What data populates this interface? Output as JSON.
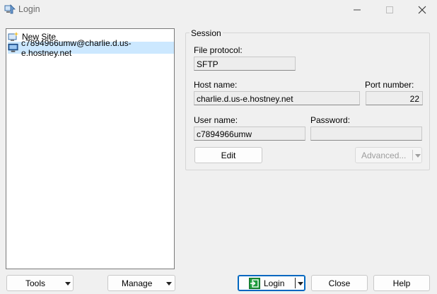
{
  "window": {
    "title": "Login"
  },
  "sites": [
    {
      "label": "New Site",
      "icon": "new-site-icon",
      "selected": false
    },
    {
      "label": "c7894966umw@charlie.d.us-e.hostney.net",
      "icon": "computer-icon",
      "selected": true
    }
  ],
  "session": {
    "group_label": "Session",
    "file_protocol_label": "File protocol:",
    "file_protocol_value": "SFTP",
    "host_label": "Host name:",
    "host_value": "charlie.d.us-e.hostney.net",
    "port_label": "Port number:",
    "port_value": "22",
    "user_label": "User name:",
    "user_value": "c7894966umw",
    "password_label": "Password:",
    "password_value": "",
    "edit_label": "Edit",
    "advanced_label": "Advanced..."
  },
  "buttons": {
    "tools": "Tools",
    "manage": "Manage",
    "login": "Login",
    "close": "Close",
    "help": "Help"
  },
  "colors": {
    "selection": "#cce8ff",
    "login_icon_green": "#1e9b3b"
  }
}
